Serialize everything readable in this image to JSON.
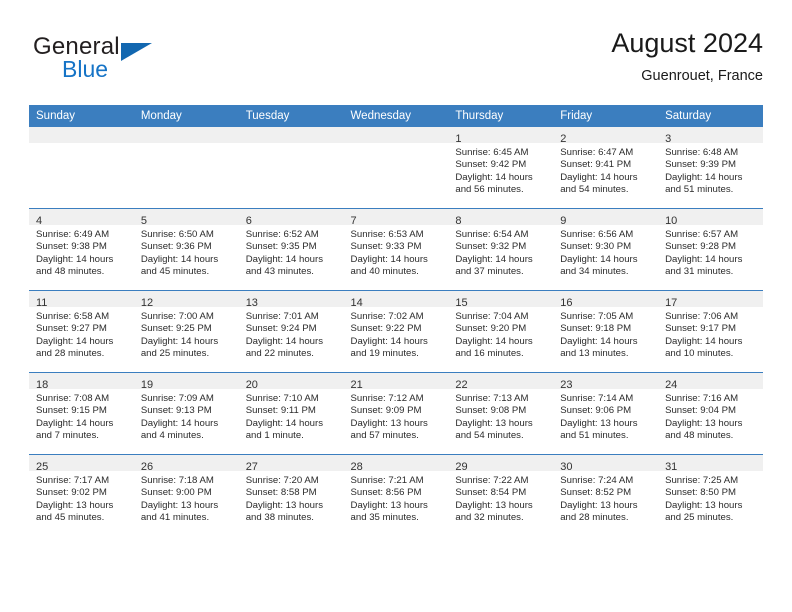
{
  "brand": {
    "name_part1": "General",
    "name_part2": "Blue",
    "triangle_color": "#1267b0",
    "blue_color": "#1573c6"
  },
  "header": {
    "title": "August 2024",
    "subtitle": "Guenrouet, France"
  },
  "theme": {
    "header_bg": "#3b7ebf",
    "header_text": "#ffffff",
    "daynum_band_bg": "#f0f0f0",
    "row_divider": "#3b7ebf",
    "cell_bg": "#ffffff"
  },
  "weekdays": [
    "Sunday",
    "Monday",
    "Tuesday",
    "Wednesday",
    "Thursday",
    "Friday",
    "Saturday"
  ],
  "labels": {
    "sunrise_prefix": "Sunrise:",
    "sunset_prefix": "Sunset:",
    "daylight_prefix": "Daylight:"
  },
  "weeks": [
    [
      {
        "day": "",
        "lines": []
      },
      {
        "day": "",
        "lines": []
      },
      {
        "day": "",
        "lines": []
      },
      {
        "day": "",
        "lines": []
      },
      {
        "day": "1",
        "lines": [
          "Sunrise: 6:45 AM",
          "Sunset: 9:42 PM",
          "Daylight: 14 hours",
          "and 56 minutes."
        ]
      },
      {
        "day": "2",
        "lines": [
          "Sunrise: 6:47 AM",
          "Sunset: 9:41 PM",
          "Daylight: 14 hours",
          "and 54 minutes."
        ]
      },
      {
        "day": "3",
        "lines": [
          "Sunrise: 6:48 AM",
          "Sunset: 9:39 PM",
          "Daylight: 14 hours",
          "and 51 minutes."
        ]
      }
    ],
    [
      {
        "day": "4",
        "lines": [
          "Sunrise: 6:49 AM",
          "Sunset: 9:38 PM",
          "Daylight: 14 hours",
          "and 48 minutes."
        ]
      },
      {
        "day": "5",
        "lines": [
          "Sunrise: 6:50 AM",
          "Sunset: 9:36 PM",
          "Daylight: 14 hours",
          "and 45 minutes."
        ]
      },
      {
        "day": "6",
        "lines": [
          "Sunrise: 6:52 AM",
          "Sunset: 9:35 PM",
          "Daylight: 14 hours",
          "and 43 minutes."
        ]
      },
      {
        "day": "7",
        "lines": [
          "Sunrise: 6:53 AM",
          "Sunset: 9:33 PM",
          "Daylight: 14 hours",
          "and 40 minutes."
        ]
      },
      {
        "day": "8",
        "lines": [
          "Sunrise: 6:54 AM",
          "Sunset: 9:32 PM",
          "Daylight: 14 hours",
          "and 37 minutes."
        ]
      },
      {
        "day": "9",
        "lines": [
          "Sunrise: 6:56 AM",
          "Sunset: 9:30 PM",
          "Daylight: 14 hours",
          "and 34 minutes."
        ]
      },
      {
        "day": "10",
        "lines": [
          "Sunrise: 6:57 AM",
          "Sunset: 9:28 PM",
          "Daylight: 14 hours",
          "and 31 minutes."
        ]
      }
    ],
    [
      {
        "day": "11",
        "lines": [
          "Sunrise: 6:58 AM",
          "Sunset: 9:27 PM",
          "Daylight: 14 hours",
          "and 28 minutes."
        ]
      },
      {
        "day": "12",
        "lines": [
          "Sunrise: 7:00 AM",
          "Sunset: 9:25 PM",
          "Daylight: 14 hours",
          "and 25 minutes."
        ]
      },
      {
        "day": "13",
        "lines": [
          "Sunrise: 7:01 AM",
          "Sunset: 9:24 PM",
          "Daylight: 14 hours",
          "and 22 minutes."
        ]
      },
      {
        "day": "14",
        "lines": [
          "Sunrise: 7:02 AM",
          "Sunset: 9:22 PM",
          "Daylight: 14 hours",
          "and 19 minutes."
        ]
      },
      {
        "day": "15",
        "lines": [
          "Sunrise: 7:04 AM",
          "Sunset: 9:20 PM",
          "Daylight: 14 hours",
          "and 16 minutes."
        ]
      },
      {
        "day": "16",
        "lines": [
          "Sunrise: 7:05 AM",
          "Sunset: 9:18 PM",
          "Daylight: 14 hours",
          "and 13 minutes."
        ]
      },
      {
        "day": "17",
        "lines": [
          "Sunrise: 7:06 AM",
          "Sunset: 9:17 PM",
          "Daylight: 14 hours",
          "and 10 minutes."
        ]
      }
    ],
    [
      {
        "day": "18",
        "lines": [
          "Sunrise: 7:08 AM",
          "Sunset: 9:15 PM",
          "Daylight: 14 hours",
          "and 7 minutes."
        ]
      },
      {
        "day": "19",
        "lines": [
          "Sunrise: 7:09 AM",
          "Sunset: 9:13 PM",
          "Daylight: 14 hours",
          "and 4 minutes."
        ]
      },
      {
        "day": "20",
        "lines": [
          "Sunrise: 7:10 AM",
          "Sunset: 9:11 PM",
          "Daylight: 14 hours",
          "and 1 minute."
        ]
      },
      {
        "day": "21",
        "lines": [
          "Sunrise: 7:12 AM",
          "Sunset: 9:09 PM",
          "Daylight: 13 hours",
          "and 57 minutes."
        ]
      },
      {
        "day": "22",
        "lines": [
          "Sunrise: 7:13 AM",
          "Sunset: 9:08 PM",
          "Daylight: 13 hours",
          "and 54 minutes."
        ]
      },
      {
        "day": "23",
        "lines": [
          "Sunrise: 7:14 AM",
          "Sunset: 9:06 PM",
          "Daylight: 13 hours",
          "and 51 minutes."
        ]
      },
      {
        "day": "24",
        "lines": [
          "Sunrise: 7:16 AM",
          "Sunset: 9:04 PM",
          "Daylight: 13 hours",
          "and 48 minutes."
        ]
      }
    ],
    [
      {
        "day": "25",
        "lines": [
          "Sunrise: 7:17 AM",
          "Sunset: 9:02 PM",
          "Daylight: 13 hours",
          "and 45 minutes."
        ]
      },
      {
        "day": "26",
        "lines": [
          "Sunrise: 7:18 AM",
          "Sunset: 9:00 PM",
          "Daylight: 13 hours",
          "and 41 minutes."
        ]
      },
      {
        "day": "27",
        "lines": [
          "Sunrise: 7:20 AM",
          "Sunset: 8:58 PM",
          "Daylight: 13 hours",
          "and 38 minutes."
        ]
      },
      {
        "day": "28",
        "lines": [
          "Sunrise: 7:21 AM",
          "Sunset: 8:56 PM",
          "Daylight: 13 hours",
          "and 35 minutes."
        ]
      },
      {
        "day": "29",
        "lines": [
          "Sunrise: 7:22 AM",
          "Sunset: 8:54 PM",
          "Daylight: 13 hours",
          "and 32 minutes."
        ]
      },
      {
        "day": "30",
        "lines": [
          "Sunrise: 7:24 AM",
          "Sunset: 8:52 PM",
          "Daylight: 13 hours",
          "and 28 minutes."
        ]
      },
      {
        "day": "31",
        "lines": [
          "Sunrise: 7:25 AM",
          "Sunset: 8:50 PM",
          "Daylight: 13 hours",
          "and 25 minutes."
        ]
      }
    ]
  ]
}
